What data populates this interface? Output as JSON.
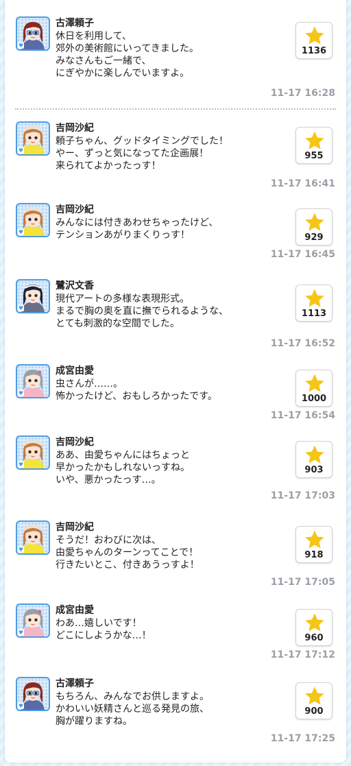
{
  "posts": [
    {
      "name": "古澤頼子",
      "message": "休日を利用して、\n郊外の美術館にいってきました。\nみなさんもご一緒で、\nにぎやかに楽しんでいますよ。",
      "likes": "1136",
      "time": "11-17 16:28",
      "avatar": "yoriko"
    },
    {
      "name": "吉岡沙紀",
      "message": "頼子ちゃん、グッドタイミングでした！\nやー、ずっと気になってた企画展！\n来られてよかったっす！",
      "likes": "955",
      "time": "11-17 16:41",
      "avatar": "saki"
    },
    {
      "name": "吉岡沙紀",
      "message": "みんなには付きあわせちゃったけど、\nテンションあがりまくりっす！",
      "likes": "929",
      "time": "11-17 16:45",
      "avatar": "saki"
    },
    {
      "name": "鷺沢文香",
      "message": "現代アートの多様な表現形式。\nまるで胸の奥を直に撫でられるような、\nとても刺激的な空間でした。",
      "likes": "1113",
      "time": "11-17 16:52",
      "avatar": "fumika"
    },
    {
      "name": "成宮由愛",
      "message": "虫さんが……。\n怖かったけど、おもしろかったです。",
      "likes": "1000",
      "time": "11-17 16:54",
      "avatar": "yume"
    },
    {
      "name": "吉岡沙紀",
      "message": "ああ、由愛ちゃんにはちょっと\n早かったかもしれないっすね。\nいや、悪かったっす…。",
      "likes": "903",
      "time": "11-17 17:03",
      "avatar": "saki"
    },
    {
      "name": "吉岡沙紀",
      "message": "そうだ！おわびに次は、\n由愛ちゃんのターンってことで！\n行きたいとこ、付きあうっすよ！",
      "likes": "918",
      "time": "11-17 17:05",
      "avatar": "saki"
    },
    {
      "name": "成宮由愛",
      "message": "わあ…嬉しいです！\nどこにしようかな…！",
      "likes": "960",
      "time": "11-17 17:12",
      "avatar": "yume"
    },
    {
      "name": "古澤頼子",
      "message": "もちろん、みんなでお供しますよ。\nかわいい妖精さんと巡る発見の旅、\n胸が躍りますね。",
      "likes": "900",
      "time": "11-17 17:25",
      "avatar": "yoriko"
    }
  ],
  "avatar_styles": {
    "yoriko": {
      "hair": "#8a2a1e",
      "skin": "#fbe3d2",
      "outfit": "#5a6aa8",
      "accent": "#2a6fd6"
    },
    "saki": {
      "hair": "#c77a3c",
      "skin": "#fbe3d2",
      "outfit": "#f3e33b",
      "accent": "#e8e2dc"
    },
    "fumika": {
      "hair": "#1f2234",
      "skin": "#fbe6d8",
      "outfit": "#6a6f86",
      "accent": "#ffffff"
    },
    "yume": {
      "hair": "#9a9ea5",
      "skin": "#fbe6d8",
      "outfit": "#f4b6c6",
      "accent": "#e06688"
    }
  },
  "colors": {
    "star": "#f5c518",
    "time": "#9aa0a6",
    "avatar_border": "#4f9be4"
  }
}
